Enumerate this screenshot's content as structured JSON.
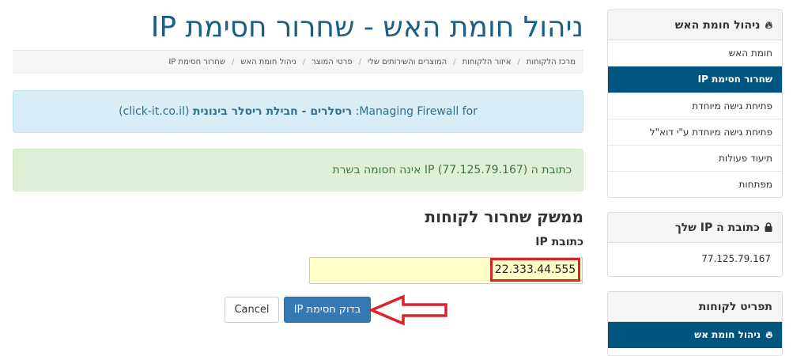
{
  "page": {
    "title": "ניהול חומת האש - שחרור חסימת IP"
  },
  "breadcrumb": [
    "מרכז הלקוחות",
    "איזור הלקוחות",
    "המוצרים והשירותים שלי",
    "פרטי המוצר",
    "ניהול חומת האש",
    "שחרור חסימת IP"
  ],
  "info_alert": {
    "prefix": "Managing Firewall for:",
    "name": "ריסלרים - חבילת ריסלר בינונית",
    "domain": "(click-it.co.il)"
  },
  "success_alert": {
    "text": "כתובת ה IP (77.125.79.167) אינה חסומה בשרת"
  },
  "form": {
    "section_title": "ממשק שחרור לקוחות",
    "ip_label": "כתובת IP",
    "ip_value": "22.333.44.555",
    "submit_label": "בדוק חסימת IP",
    "cancel_label": "Cancel"
  },
  "sidebar": {
    "firewall_panel": {
      "title": "ניהול חומת האש",
      "icon": "fire-icon",
      "items": [
        {
          "label": "חומת האש",
          "active": false
        },
        {
          "label": "שחרור חסימת IP",
          "active": true
        },
        {
          "label": "פתיחת גישה מיוחדת",
          "active": false
        },
        {
          "label": "פתיחת גישה מיוחדת ע\"י דוא\"ל",
          "active": false
        },
        {
          "label": "תיעוד פעולות",
          "active": false
        },
        {
          "label": "מפתחות",
          "active": false
        }
      ]
    },
    "ip_panel": {
      "title": "כתובת ה IP שלך",
      "icon": "lock-icon",
      "ip": "77.125.79.167"
    },
    "client_menu_panel": {
      "title": "תפריט לקוחות",
      "items": [
        {
          "label": "ניהול חומת אש",
          "icon": "fire-icon",
          "active": true
        }
      ]
    }
  },
  "colors": {
    "active_bg": "#005580",
    "primary_button": "#337ab7",
    "highlight_border": "#d9222a",
    "input_bg": "#ffffc8"
  }
}
